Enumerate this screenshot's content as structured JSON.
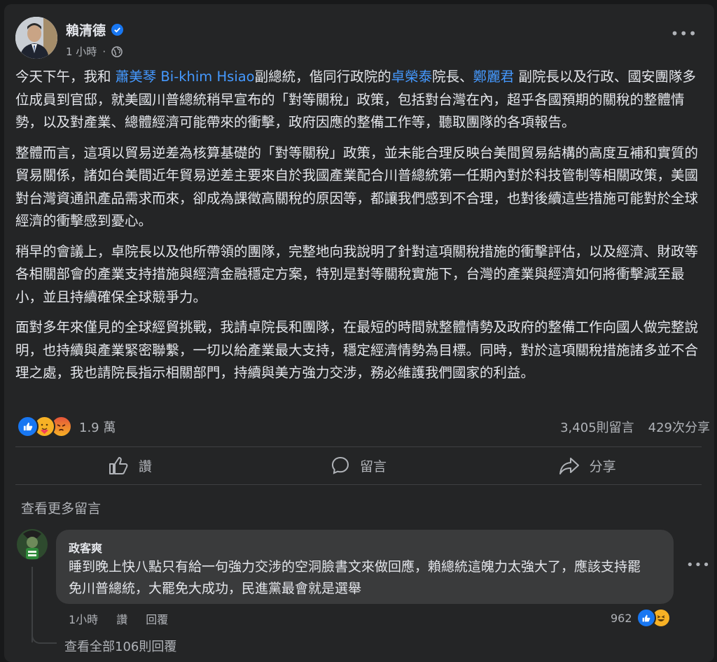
{
  "post": {
    "author": "賴清德",
    "time": "1 小時",
    "paragraphs": [
      [
        {
          "t": "今天下午，我和 ",
          "link": false
        },
        {
          "t": "蕭美琴 Bi-khim Hsiao",
          "link": true
        },
        {
          "t": "副總統，偕同行政院的",
          "link": false
        },
        {
          "t": "卓榮泰",
          "link": true
        },
        {
          "t": "院長、",
          "link": false
        },
        {
          "t": "鄭麗君",
          "link": true
        },
        {
          "t": " 副院長以及行政、國安團隊多位成員到官邸，就美國川普總統稍早宣布的「對等關稅」政策，包括對台灣在內，超乎各國預期的關稅的整體情勢，以及對產業、總體經濟可能帶來的衝擊，政府因應的整備工作等，聽取團隊的各項報告。",
          "link": false
        }
      ],
      [
        {
          "t": "整體而言，這項以貿易逆差為核算基礎的「對等關稅」政策，並未能合理反映台美間貿易結構的高度互補和實質的貿易關係，諸如台美間近年貿易逆差主要來自於我國產業配合川普總統第一任期內對於科技管制等相關政策，美國對台灣資通訊產品需求而來，卻成為課徵高關稅的原因等，都讓我們感到不合理，也對後續這些措施可能對於全球經濟的衝擊感到憂心。",
          "link": false
        }
      ],
      [
        {
          "t": "稍早的會議上，卓院長以及他所帶領的團隊，完整地向我說明了針對這項關稅措施的衝擊評估，以及經濟、財政等各相關部會的產業支持措施與經濟金融穩定方案，特別是對等關稅實施下，台灣的產業與經濟如何將衝擊減至最小，並且持續確保全球競爭力。",
          "link": false
        }
      ],
      [
        {
          "t": "面對多年來僅見的全球經貿挑戰，我請卓院長和團隊，在最短的時間就整體情勢及政府的整備工作向國人做完整說明，也持續與產業緊密聯繫，一切以給產業最大支持，穩定經濟情勢為目標。同時，對於這項關稅措施諸多並不合理之處，我也請院長指示相關部門，持續與美方強力交涉，務必維護我們國家的利益。",
          "link": false
        }
      ]
    ],
    "reactions": {
      "count": "1.9 萬",
      "icons": [
        "like-icon",
        "care-icon",
        "angry-icon"
      ]
    },
    "comments_count": "3,405則留言",
    "shares_count": "429次分享"
  },
  "actions": {
    "like": "讚",
    "comment": "留言",
    "share": "分享"
  },
  "see_more": "查看更多留言",
  "comment": {
    "name": "政客爽",
    "text": "睡到晚上快八點只有給一句強力交涉的空洞臉書文來做回應，賴總統這魄力太強大了，應該支持罷免川普總統，大罷免大成功，民進黨最會就是選舉",
    "time": "1小時",
    "like": "讚",
    "reply": "回覆",
    "reaction_count": "962",
    "view_replies": "查看全部106則回覆"
  },
  "colors": {
    "background": "#18191a",
    "card": "#242526",
    "link": "#4599ff",
    "text": "#e4e6eb",
    "secondary": "#b0b3b8",
    "bubble": "#3a3b3c",
    "like": "#1877f2",
    "angry": "#e9710f",
    "care": "#f7b125"
  }
}
